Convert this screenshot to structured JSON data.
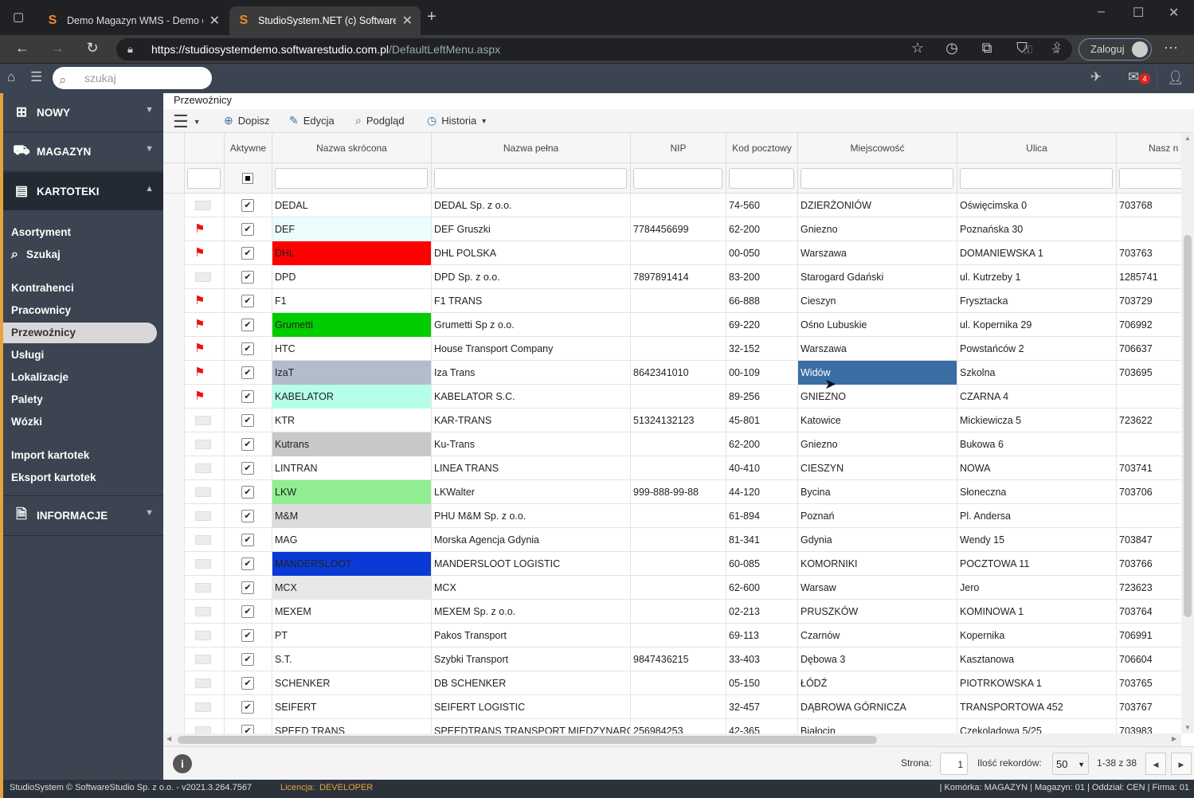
{
  "browser": {
    "tabs": [
      {
        "title": "Demo Magazyn WMS - Demo o",
        "favicon": "S"
      },
      {
        "title": "StudioSystem.NET (c) SoftwareSt",
        "favicon": "S"
      }
    ],
    "url_host": "https://studiosystemdemo.softwarestudio.com.pl",
    "url_path": "/DefaultLeftMenu.aspx",
    "login_label": "Zaloguj"
  },
  "header": {
    "search_placeholder": "szukaj",
    "mail_badge": "4"
  },
  "sidebar": {
    "sections": [
      {
        "label": "NOWY",
        "icon": "plus-square-icon"
      },
      {
        "label": "MAGAZYN",
        "icon": "forklift-icon"
      },
      {
        "label": "KARTOTEKI",
        "icon": "card-icon"
      },
      {
        "label": "INFORMACJE",
        "icon": "document-icon"
      }
    ],
    "items": [
      "Asortyment",
      "Szukaj",
      "Kontrahenci",
      "Pracownicy",
      "Przewoźnicy",
      "Usługi",
      "Lokalizacje",
      "Palety",
      "Wózki",
      "Import kartotek",
      "Eksport kartotek"
    ],
    "active": "Przewoźnicy"
  },
  "breadcrumb": "Przewoźnicy",
  "toolbar": {
    "add": "Dopisz",
    "edit": "Edycja",
    "view": "Podgląd",
    "history": "Historia"
  },
  "grid": {
    "columns": [
      "",
      "Aktywne",
      "Nazwa skrócona",
      "Nazwa pełna",
      "NIP",
      "Kod pocztowy",
      "Miejscowość",
      "Ulica",
      "Nasz n"
    ],
    "rows": [
      {
        "flag": false,
        "short": "DEDAL",
        "full": "DEDAL Sp. z o.o.",
        "nip": "",
        "zip": "74-560",
        "city": "DZIERŻONIÓW",
        "street": "Oświęcimska 0",
        "no": "703768",
        "color": ""
      },
      {
        "flag": true,
        "short": "DEF",
        "full": "DEF Gruszki",
        "nip": "7784456699",
        "zip": "62-200",
        "city": "Gniezno",
        "street": "Poznańska 30",
        "no": "",
        "color": "#eafcfc"
      },
      {
        "flag": true,
        "short": "DHL",
        "full": "DHL POLSKA",
        "nip": "",
        "zip": "00-050",
        "city": "Warszawa",
        "street": "DOMANIEWSKA 1",
        "no": "703763",
        "color": "#ff0000"
      },
      {
        "flag": false,
        "short": "DPD",
        "full": "DPD Sp. z o.o.",
        "nip": "7897891414",
        "zip": "83-200",
        "city": "Starogard Gdański",
        "street": "ul. Kutrzeby 1",
        "no": "1285741",
        "color": ""
      },
      {
        "flag": true,
        "short": "F1",
        "full": "F1 TRANS",
        "nip": "",
        "zip": "66-888",
        "city": "Cieszyn",
        "street": "Frysztacka",
        "no": "703729",
        "color": ""
      },
      {
        "flag": true,
        "short": "Grumetti",
        "full": "Grumetti Sp z o.o.",
        "nip": "",
        "zip": "69-220",
        "city": "Ośno Lubuskie",
        "street": "ul. Kopernika 29",
        "no": "706992",
        "color": "#00cc00"
      },
      {
        "flag": true,
        "short": "HTC",
        "full": "House Transport Company",
        "nip": "",
        "zip": "32-152",
        "city": "Warszawa",
        "street": "Powstańców 2",
        "no": "706637",
        "color": ""
      },
      {
        "flag": true,
        "short": "IzaT",
        "full": "Iza Trans",
        "nip": "8642341010",
        "zip": "00-109",
        "city": "Widów",
        "street": "Szkolna",
        "no": "703695",
        "color": "#b3bccb"
      },
      {
        "flag": true,
        "short": "KABELATOR",
        "full": "KABELATOR S.C.",
        "nip": "",
        "zip": "89-256",
        "city": "GNIEZNO",
        "street": "CZARNA 4",
        "no": "",
        "color": "#b5ffe8"
      },
      {
        "flag": false,
        "short": "KTR",
        "full": "KAR-TRANS",
        "nip": "51324132123",
        "zip": "45-801",
        "city": "Katowice",
        "street": "Mickiewicza 5",
        "no": "723622",
        "color": ""
      },
      {
        "flag": false,
        "short": "Kutrans",
        "full": "Ku-Trans",
        "nip": "",
        "zip": "62-200",
        "city": "Gniezno",
        "street": "Bukowa 6",
        "no": "",
        "color": "#c8c8c8"
      },
      {
        "flag": false,
        "short": "LINTRAN",
        "full": "LINEA TRANS",
        "nip": "",
        "zip": "40-410",
        "city": "CIESZYN",
        "street": "NOWA",
        "no": "703741",
        "color": ""
      },
      {
        "flag": false,
        "short": "LKW",
        "full": "LKWalter",
        "nip": "999-888-99-88",
        "zip": "44-120",
        "city": "Bycina",
        "street": "Słoneczna",
        "no": "703706",
        "color": "#90ee90"
      },
      {
        "flag": false,
        "short": "M&M",
        "full": "PHU M&M Sp. z o.o.",
        "nip": "",
        "zip": "61-894",
        "city": "Poznań",
        "street": "Pl. Andersa",
        "no": "",
        "color": "#dcdcdc"
      },
      {
        "flag": false,
        "short": "MAG",
        "full": "Morska Agencja Gdynia",
        "nip": "",
        "zip": "81-341",
        "city": "Gdynia",
        "street": "Wendy 15",
        "no": "703847",
        "color": ""
      },
      {
        "flag": false,
        "short": "MANDERSLOOT",
        "full": "MANDERSLOOT LOGISTIC",
        "nip": "",
        "zip": "60-085",
        "city": "KOMORNIKI",
        "street": "POCZTOWA 11",
        "no": "703766",
        "color": "#0a3ad6"
      },
      {
        "flag": false,
        "short": "MCX",
        "full": "MCX",
        "nip": "",
        "zip": "62-600",
        "city": "Warsaw",
        "street": "Jero",
        "no": "723623",
        "color": "#e8e8e8"
      },
      {
        "flag": false,
        "short": "MEXEM",
        "full": "MEXEM Sp. z o.o.",
        "nip": "",
        "zip": "02-213",
        "city": "PRUSZKÓW",
        "street": "KOMINOWA 1",
        "no": "703764",
        "color": ""
      },
      {
        "flag": false,
        "short": "PT",
        "full": "Pakos Transport",
        "nip": "",
        "zip": "69-113",
        "city": "Czarnów",
        "street": "Kopernika",
        "no": "706991",
        "color": ""
      },
      {
        "flag": false,
        "short": "S.T.",
        "full": "Szybki Transport",
        "nip": "9847436215",
        "zip": "33-403",
        "city": "Dębowa 3",
        "street": "Kasztanowa",
        "no": "706604",
        "color": ""
      },
      {
        "flag": false,
        "short": "SCHENKER",
        "full": "DB SCHENKER",
        "nip": "",
        "zip": "05-150",
        "city": "ŁÓDŹ",
        "street": "PIOTRKOWSKA 1",
        "no": "703765",
        "color": ""
      },
      {
        "flag": false,
        "short": "SEIFERT",
        "full": "SEIFERT LOGISTIC",
        "nip": "",
        "zip": "32-457",
        "city": "DĄBROWA GÓRNICZA",
        "street": "TRANSPORTOWA 452",
        "no": "703767",
        "color": ""
      },
      {
        "flag": false,
        "short": "SPEED TRANS",
        "full": "SPEEDTRANS TRANSPORT MIEDZYNARO",
        "nip": "256984253",
        "zip": "42-365",
        "city": "Białocin",
        "street": "Czekoladowa 5/25",
        "no": "703983",
        "color": ""
      }
    ],
    "selected_row": 7,
    "selected_cell_color": "#3a6ea5"
  },
  "pager": {
    "page_label": "Strona:",
    "page_value": "1",
    "count_label": "Ilość rekordów:",
    "count_value": "50",
    "range": "1-38 z 38"
  },
  "footer": {
    "copyright": "StudioSystem © SoftwareStudio Sp. z o.o. - v2021.3.264.7567",
    "license_label": "Licencja:",
    "license_value": "DEVELOPER",
    "status": "| Komórka: MAGAZYN | Magazyn: 01 | Oddział: CEN | Firma: 01"
  }
}
